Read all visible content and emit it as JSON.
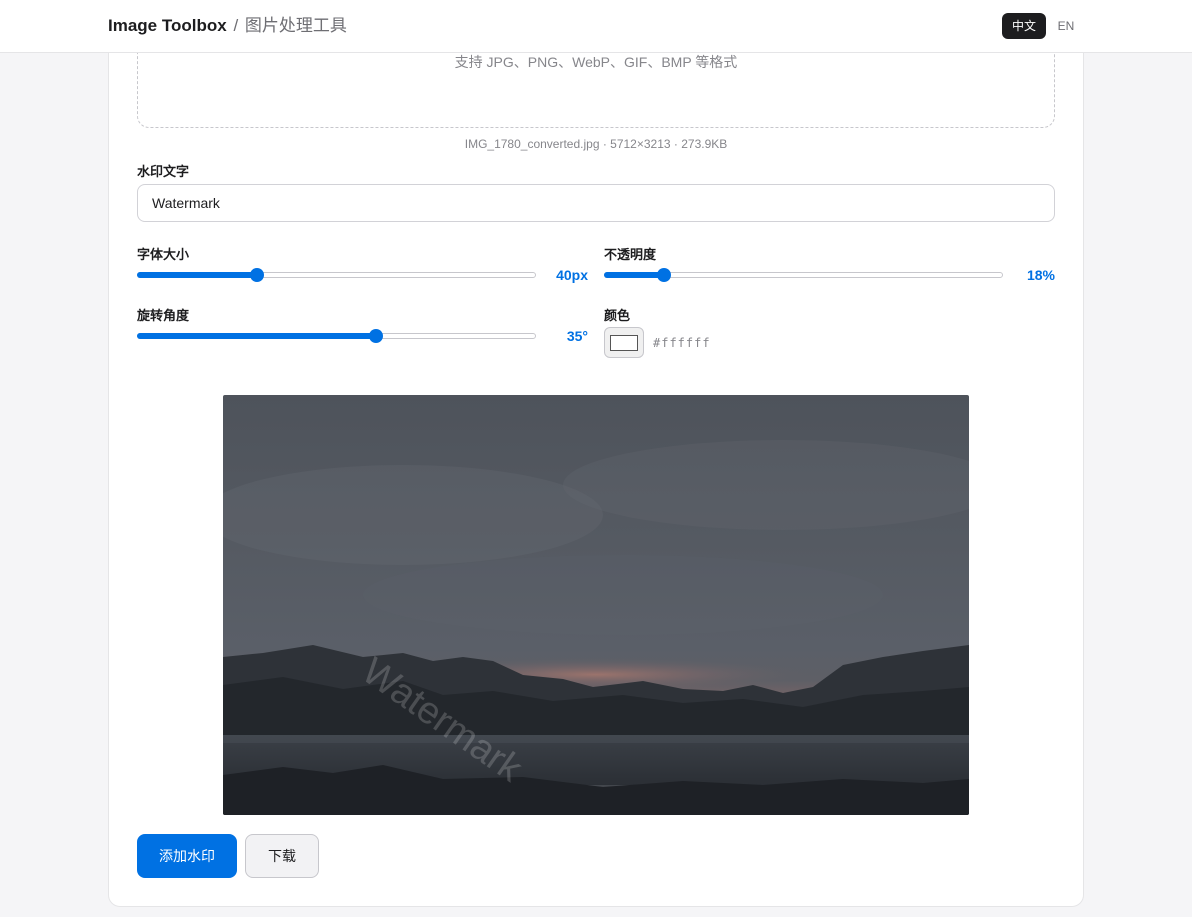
{
  "header": {
    "brand": "Image Toolbox",
    "separator": "/",
    "subtitle": "图片处理工具",
    "lang_zh": "中文",
    "lang_en": "EN",
    "active_lang": "zh"
  },
  "dropzone": {
    "hint": "支持 JPG、PNG、WebP、GIF、BMP 等格式"
  },
  "file": {
    "info": "IMG_1780_converted.jpg · 5712×3213 · 273.9KB"
  },
  "watermark": {
    "text_label": "水印文字",
    "text_value": "Watermark",
    "font_size_label": "字体大小",
    "font_size_display": "40px",
    "font_size_level": 0.3,
    "opacity_label": "不透明度",
    "opacity_display": "18%",
    "opacity_level": 0.15,
    "rotation_label": "旋转角度",
    "rotation_display": "35°",
    "rotation_level": 0.6,
    "color_label": "颜色",
    "color_value": "#ffffff"
  },
  "preview": {
    "overlay_text": "Watermark"
  },
  "actions": {
    "apply_label": "添加水印",
    "download_label": "下载"
  },
  "colors": {
    "accent": "#0071e3",
    "active_lang_bg": "#1d1d1f"
  }
}
